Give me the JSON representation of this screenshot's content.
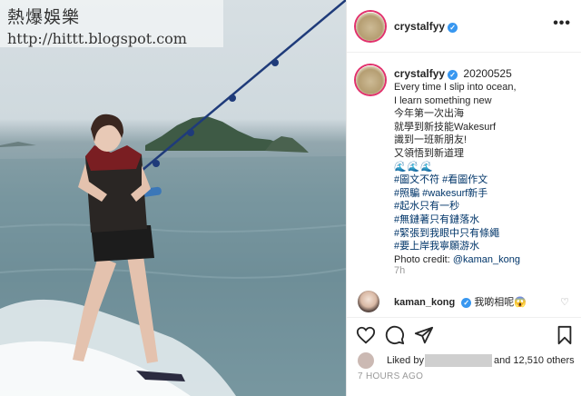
{
  "watermark": {
    "title": "熱爆娛樂",
    "url": "http://hittt.blogspot.com"
  },
  "post": {
    "header": {
      "username": "crystalfyy",
      "verified_icon": "verified-badge-icon",
      "more_icon": "more-options-icon",
      "more_glyph": "•••"
    },
    "caption": {
      "username": "crystalfyy",
      "date": "20200525",
      "lines": [
        {
          "text": "Every time I slip into ocean,",
          "type": "plain"
        },
        {
          "text": "I learn something new",
          "type": "plain"
        },
        {
          "text": "今年第一次出海",
          "type": "plain"
        },
        {
          "text": "就學到新技能Wakesurf",
          "type": "plain"
        },
        {
          "text": "識到一班新朋友!",
          "type": "plain"
        },
        {
          "text": "又領悟到新道理",
          "type": "plain"
        },
        {
          "text": "🌊🌊🌊",
          "type": "wave"
        },
        {
          "text": "#圖文不符 #看圖作文",
          "type": "tag"
        },
        {
          "text": "#照騙 #wakesurf新手",
          "type": "tag"
        },
        {
          "text": "#起水只有一秒",
          "type": "tag"
        },
        {
          "text": "#無鏈著只有鏈落水",
          "type": "tag"
        },
        {
          "text": "#緊張到我眼中只有條繩",
          "type": "tag"
        },
        {
          "text": "#要上岸我寧願游水",
          "type": "tag"
        },
        {
          "text": "Photo credit: @kaman_kong",
          "type": "credit"
        }
      ],
      "age": "7h"
    },
    "comment": {
      "username": "kaman_kong",
      "text": "我啲相呢😱",
      "heart_glyph": "♡"
    },
    "actions": {
      "like_icon": "heart-icon",
      "comment_icon": "comment-icon",
      "share_icon": "share-icon",
      "save_icon": "bookmark-icon"
    },
    "likes": {
      "prefix": "Liked by",
      "count_text": "and 12,510 others"
    },
    "time_ago": "7 HOURS AGO"
  }
}
